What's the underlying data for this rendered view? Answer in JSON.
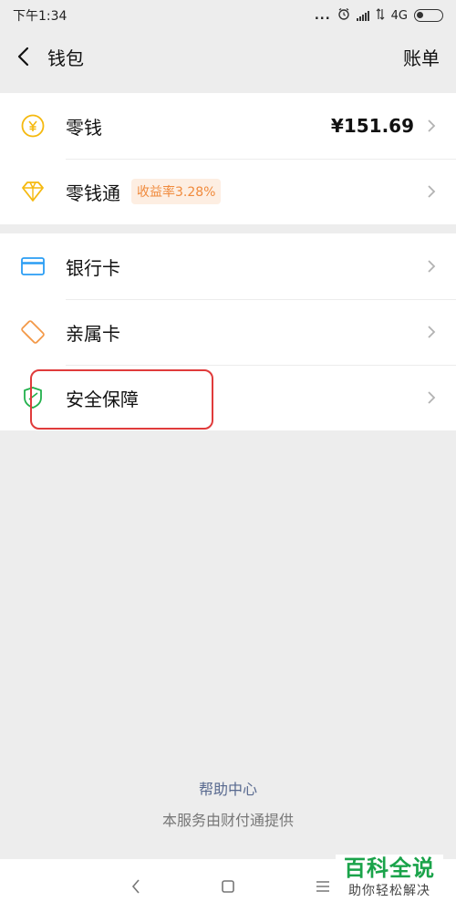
{
  "status_bar": {
    "time": "下午1:34",
    "dots": "...",
    "network": "4G"
  },
  "header": {
    "title": "钱包",
    "right_action": "账单"
  },
  "groups": [
    {
      "items": [
        {
          "label": "零钱",
          "value": "¥151.69",
          "icon": "yuan-coin-icon"
        },
        {
          "label": "零钱通",
          "badge": "收益率3.28%",
          "icon": "diamond-icon"
        }
      ]
    },
    {
      "items": [
        {
          "label": "银行卡",
          "icon": "bank-card-icon"
        },
        {
          "label": "亲属卡",
          "icon": "family-card-icon"
        },
        {
          "label": "安全保障",
          "icon": "shield-icon"
        }
      ]
    }
  ],
  "footer": {
    "help_link": "帮助中心",
    "provider_text": "本服务由财付通提供"
  },
  "watermark": {
    "main": "百科全说",
    "sub": "助你轻松解决"
  },
  "colors": {
    "accent_link": "#58698f",
    "badge_text": "#f08a3c",
    "highlight": "#e03b3b",
    "coin": "#f5b90f",
    "bank_card": "#2a9df4",
    "family_card": "#f39a4a",
    "shield": "#22b14c"
  }
}
